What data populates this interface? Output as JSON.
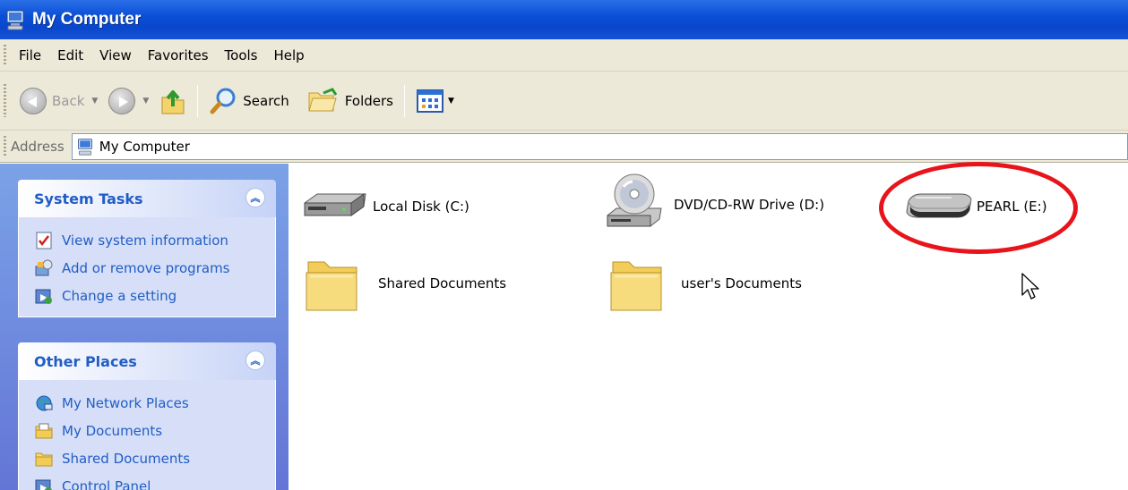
{
  "window": {
    "title": "My Computer"
  },
  "menu": [
    "File",
    "Edit",
    "View",
    "Favorites",
    "Tools",
    "Help"
  ],
  "toolbar": {
    "back_label": "Back",
    "search_label": "Search",
    "folders_label": "Folders"
  },
  "address": {
    "label": "Address",
    "value": "My Computer"
  },
  "system_tasks": {
    "title": "System Tasks",
    "items": [
      "View system information",
      "Add or remove programs",
      "Change a setting"
    ]
  },
  "other_places": {
    "title": "Other Places",
    "items": [
      "My Network Places",
      "My Documents",
      "Shared Documents",
      "Control Panel"
    ]
  },
  "drives": [
    {
      "label": "Local Disk (C:)",
      "icon": "hard-disk-icon"
    },
    {
      "label": "DVD/CD-RW Drive (D:)",
      "icon": "dvd-drive-icon"
    },
    {
      "label": "PEARL (E:)",
      "icon": "removable-drive-icon"
    }
  ],
  "folders": [
    {
      "label": "Shared Documents",
      "icon": "folder-icon"
    },
    {
      "label": "user's Documents",
      "icon": "folder-icon"
    }
  ],
  "colors": {
    "titlebar": "#0a4fd8",
    "task_link": "#215dc6",
    "highlight": "#e8141b"
  }
}
